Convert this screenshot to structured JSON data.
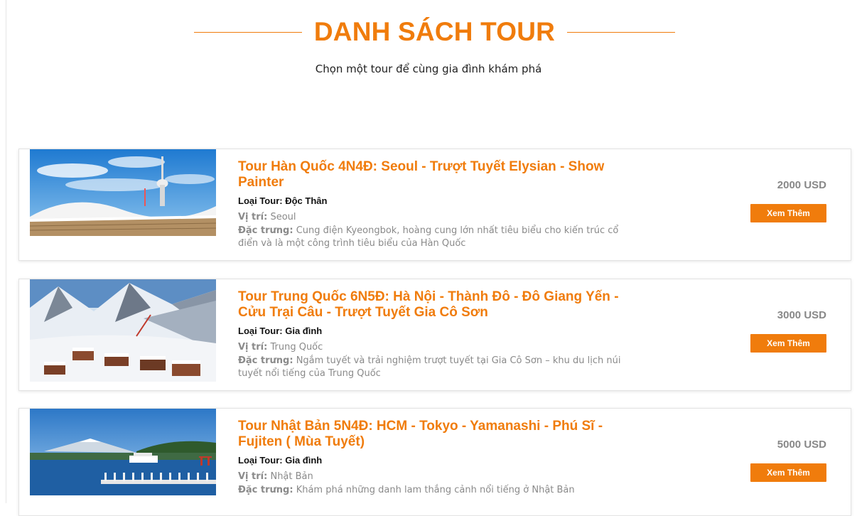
{
  "header": {
    "title": "DANH SÁCH TOUR",
    "subtitle": "Chọn một tour để cùng gia đình khám phá"
  },
  "labels": {
    "type": "Loại Tour:",
    "location": "Vị trí:",
    "feature": "Đặc trưng:",
    "more_button": "Xem Thêm"
  },
  "colors": {
    "accent": "#f07c0c",
    "muted_text": "#8a8a8a",
    "price_text": "#888888"
  },
  "tours": [
    {
      "title": "Tour Hàn Quốc 4N4Đ: Seoul - Trượt Tuyết Elysian - Show Painter",
      "type": "Độc Thân",
      "location": "Seoul",
      "feature": "Cung điện Kyeongbok, hoàng cung lớn nhất tiêu biểu cho kiến trúc cổ điển và là một công trình tiêu biểu của Hàn Quốc",
      "price": "2000 USD",
      "image": "seoul-tower-palace-photo"
    },
    {
      "title": "Tour Trung Quốc 6N5Đ: Hà Nội - Thành Đô - Đô Giang Yến - Cửu Trại Câu - Trượt Tuyết Gia Cô Sơn",
      "type": "Gia đình",
      "location": "Trung Quốc",
      "feature": "Ngắm tuyết và trải nghiệm trượt tuyết tại Gia Cô Sơn – khu du lịch núi tuyết nổi tiếng của Trung Quốc",
      "price": "3000 USD",
      "image": "snowy-mountain-village-photo"
    },
    {
      "title": "Tour Nhật Bản 5N4Đ: HCM - Tokyo - Yamanashi - Phú Sĩ - Fujiten ( Mùa Tuyết)",
      "type": "Gia đình",
      "location": "Nhật Bản",
      "feature": "Khám phá những danh lam thắng cảnh nổi tiếng ở Nhật Bản",
      "price": "5000 USD",
      "image": "mount-fuji-lake-photo"
    }
  ]
}
